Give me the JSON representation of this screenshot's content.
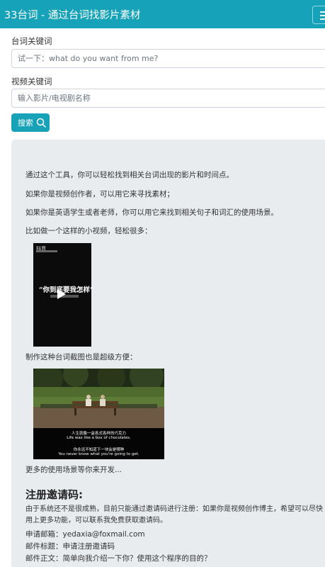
{
  "navbar": {
    "brand": "33台词 - 通过台词找影片素材"
  },
  "form": {
    "subtitle_label": "台词关键词",
    "subtitle_placeholder": "试一下：what do you want from me?",
    "video_label": "视频关键词",
    "video_placeholder": "输入影片/电视剧名称",
    "search_button": "搜索",
    "search_icon": "search-icon"
  },
  "intro": {
    "p1": "通过这个工具，你可以轻松找到相关台词出现的影片和时间点。",
    "p2": "如果你是视频创作者，可以用它来寻找素材；",
    "p3": "如果你是英语学生或者老师，你可以用它来找到相关句子和词汇的使用场景。",
    "p4": "比如做一个这样的小视频，轻松很多：",
    "video_quote": "“你到底要我怎样”",
    "tiktok_logo": "抖音",
    "p5": "制作这种台词截图也是超级方便：",
    "movie_sub_cn_1": "人生就像一盒各式各样的巧克力",
    "movie_sub_en_1": "Life was like a box of chocolates.",
    "movie_sub_cn_2": "你永远不知道下一块会是哪种",
    "movie_sub_en_2": "You never know what you're going to get.",
    "p6": "更多的使用场景等你来开发..."
  },
  "register": {
    "title": "注册邀请码:",
    "description": "由于系统还不是很成熟，目前只能通过邀请码进行注册：如果你是视频创作博主，希望可以尽快用上更多功能，可以联系我免费获取邀请码。",
    "email": "申请邮箱：yedaxia@foxmail.com",
    "subject": "邮件标题：申请注册邀请码",
    "body": "邮件正文：简单向我介绍一下你？使用这个程序的目的？"
  },
  "colors": {
    "navbar": "#16a2b8",
    "button": "#17a2b8",
    "panel": "#e9ecef"
  }
}
